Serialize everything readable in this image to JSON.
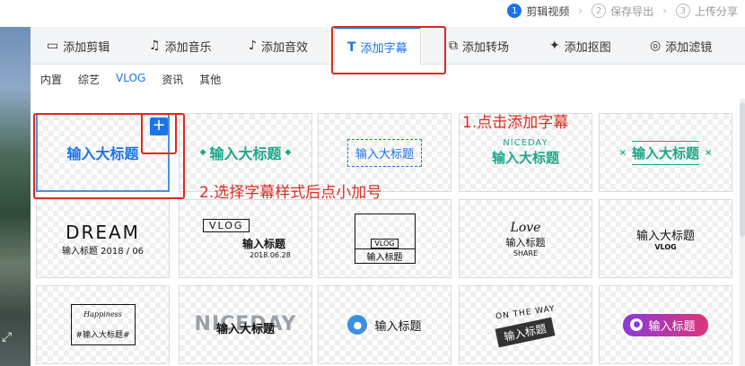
{
  "steps": [
    {
      "num": "1",
      "label": "剪辑视频",
      "active": true
    },
    {
      "num": "2",
      "label": "保存导出"
    },
    {
      "num": "3",
      "label": "上传分享"
    }
  ],
  "tabs": [
    {
      "icon": "▭",
      "label": "添加剪辑"
    },
    {
      "icon": "♫",
      "label": "添加音乐"
    },
    {
      "icon": "♪",
      "label": "添加音效"
    },
    {
      "icon": "T",
      "label": "添加字幕",
      "active": true
    },
    {
      "icon": "⧉",
      "label": "添加转场"
    },
    {
      "icon": "✦",
      "label": "添加抠图"
    },
    {
      "icon": "◎",
      "label": "添加滤镜"
    }
  ],
  "categories": [
    "内置",
    "综艺",
    "VLOG",
    "资讯",
    "其他"
  ],
  "active_category": "VLOG",
  "plus_symbol": "+",
  "templates": [
    {
      "main": "输入大标题"
    },
    {
      "main": "输入大标题",
      "deco": "◆"
    },
    {
      "main": "输入大标题"
    },
    {
      "main": "输入大标题",
      "top": "NICEDAY"
    },
    {
      "main": "输入大标题",
      "mark": "×"
    },
    {
      "top": "DREAM",
      "main": "输入标题",
      "sub": "2018 / 06"
    },
    {
      "top": "VLOG",
      "main": "输入标题",
      "sub": "2018.06.28"
    },
    {
      "top": "VLOG",
      "main": "输入标题"
    },
    {
      "top": "Love",
      "main": "输入标题",
      "sub": "SHARE"
    },
    {
      "main": "输入大标题",
      "sub": "VLOG"
    },
    {
      "top": "Happiness",
      "main": "#输入大标题#"
    },
    {
      "top": "NICEDAY",
      "main": "输入大标题"
    },
    {
      "main": "输入标题"
    },
    {
      "top": "ON THE WAY",
      "main": "输入标题"
    },
    {
      "main": "输入标题"
    }
  ],
  "annotations": {
    "step1": "1.点击添加字幕",
    "step2": "2.选择字幕样式后点小加号"
  }
}
